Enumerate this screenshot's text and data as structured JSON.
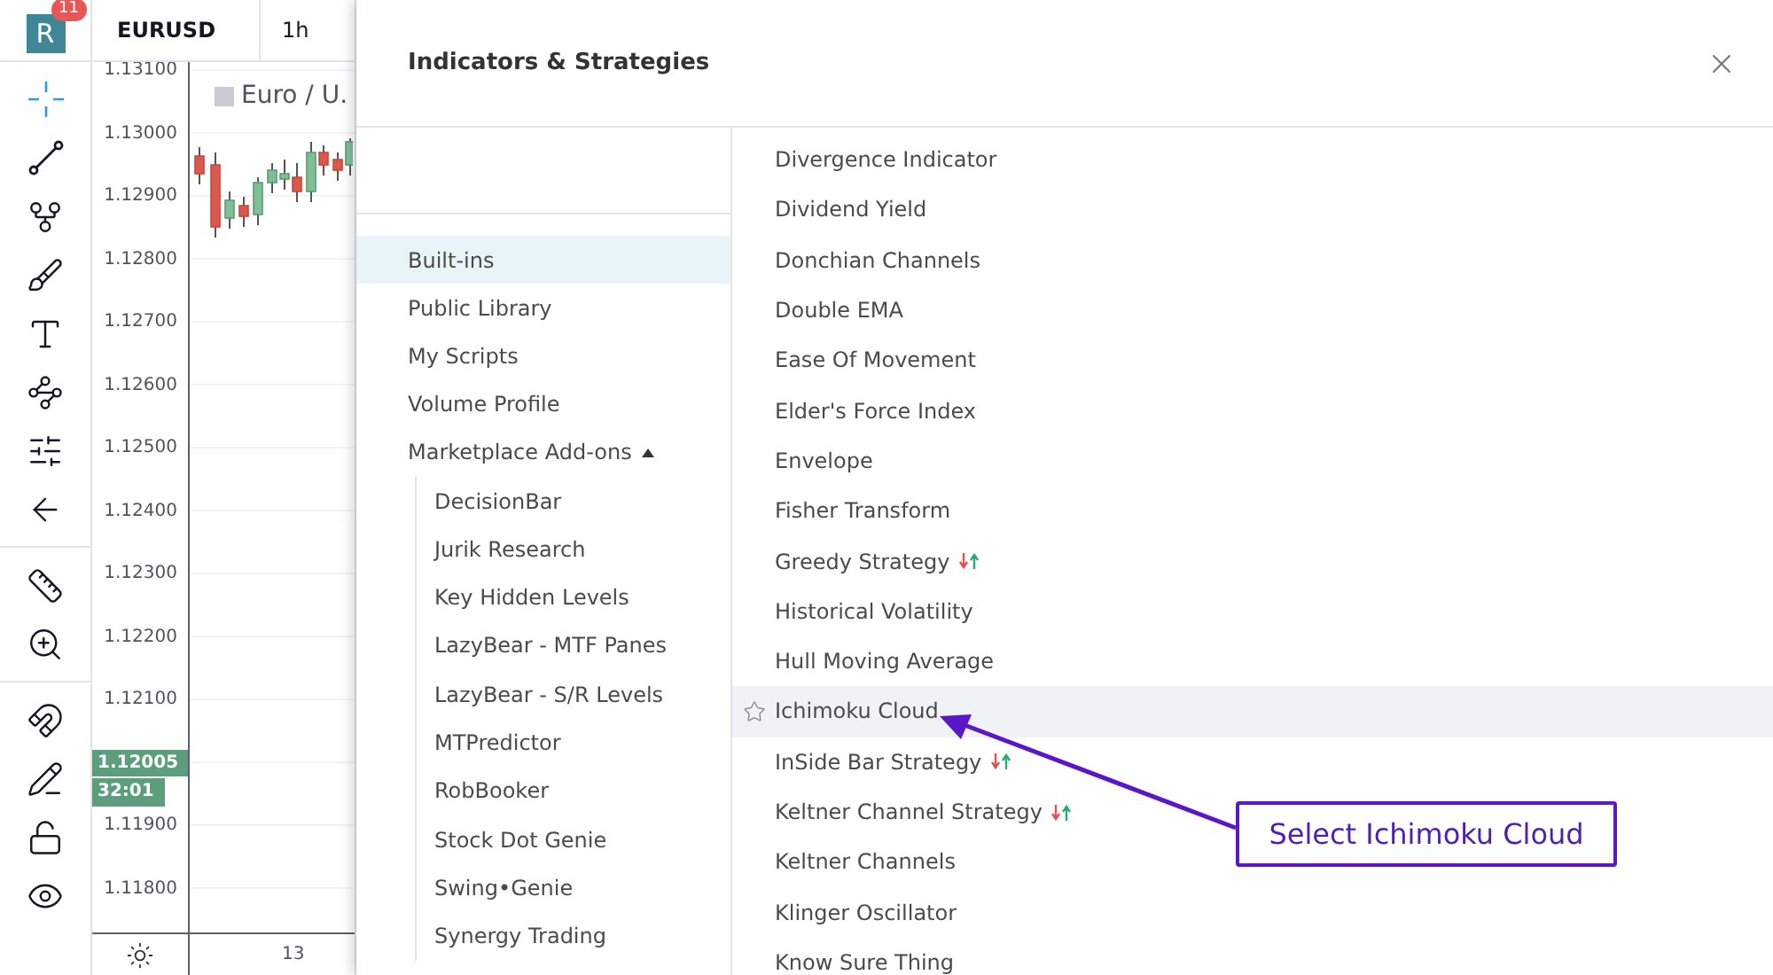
{
  "logo": {
    "letter": "R",
    "badge": "11"
  },
  "toolbar": {
    "groups": [
      [
        {
          "kind": "crosshair",
          "selected": true
        },
        {
          "kind": "trend-line",
          "selected": false
        },
        {
          "kind": "fork",
          "selected": false
        },
        {
          "kind": "brush",
          "selected": false
        },
        {
          "kind": "text",
          "selected": false
        },
        {
          "kind": "pattern",
          "selected": false
        },
        {
          "kind": "sliders",
          "selected": false
        },
        {
          "kind": "arrow-left",
          "selected": false
        }
      ],
      [
        {
          "kind": "ruler",
          "selected": false
        },
        {
          "kind": "zoom-in",
          "selected": false
        }
      ],
      [
        {
          "kind": "magnet",
          "selected": false
        },
        {
          "kind": "pencil-lock",
          "selected": false
        },
        {
          "kind": "unlock",
          "selected": false
        },
        {
          "kind": "eye",
          "selected": false
        }
      ]
    ]
  },
  "chart": {
    "symbol": "EURUSD",
    "interval": "1h",
    "legend": "Euro / U.",
    "axis": [
      {
        "kind": "label",
        "text": "1.13100"
      },
      {
        "kind": "label",
        "text": "1.13000"
      },
      {
        "kind": "label",
        "text": "1.12900"
      },
      {
        "kind": "label",
        "text": "1.12800"
      },
      {
        "kind": "label",
        "text": "1.12700"
      },
      {
        "kind": "label",
        "text": "1.12600"
      },
      {
        "kind": "label",
        "text": "1.12500"
      },
      {
        "kind": "label",
        "text": "1.12400"
      },
      {
        "kind": "label",
        "text": "1.12300"
      },
      {
        "kind": "label",
        "text": "1.12200"
      },
      {
        "kind": "label",
        "text": "1.12100"
      },
      {
        "kind": "price_tag",
        "text": "1.12005",
        "countdown": "32:01"
      },
      {
        "kind": "label",
        "text": "1.11900"
      },
      {
        "kind": "label",
        "text": "1.11800"
      }
    ],
    "time_labels": [
      "13"
    ]
  },
  "dialog": {
    "title": "Indicators & Strategies",
    "categories": [
      {
        "label": "Built-ins",
        "selected": true
      },
      {
        "label": "Public Library",
        "selected": false
      },
      {
        "label": "My Scripts",
        "selected": false
      },
      {
        "label": "Volume Profile",
        "selected": false
      },
      {
        "label": "Marketplace Add-ons",
        "selected": false,
        "expanded": true,
        "children": [
          {
            "label": "DecisionBar",
            "selected": false
          },
          {
            "label": "Jurik Research",
            "selected": false
          },
          {
            "label": "Key Hidden Levels",
            "selected": false
          },
          {
            "label": "LazyBear - MTF Panes",
            "selected": false
          },
          {
            "label": "LazyBear - S/R Levels",
            "selected": false
          },
          {
            "label": "MTPredictor",
            "selected": false
          },
          {
            "label": "RobBooker",
            "selected": false
          },
          {
            "label": "Stock Dot Genie",
            "selected": false
          },
          {
            "label": "Swing•Genie",
            "selected": false
          },
          {
            "label": "Synergy Trading",
            "selected": false
          }
        ]
      }
    ],
    "results": [
      {
        "name": "Divergence Indicator",
        "kind": "indicator",
        "highlighted": false
      },
      {
        "name": "Dividend Yield",
        "kind": "indicator",
        "highlighted": false
      },
      {
        "name": "Donchian Channels",
        "kind": "indicator",
        "highlighted": false
      },
      {
        "name": "Double EMA",
        "kind": "indicator",
        "highlighted": false
      },
      {
        "name": "Ease Of Movement",
        "kind": "indicator",
        "highlighted": false
      },
      {
        "name": "Elder's Force Index",
        "kind": "indicator",
        "highlighted": false
      },
      {
        "name": "Envelope",
        "kind": "indicator",
        "highlighted": false
      },
      {
        "name": "Fisher Transform",
        "kind": "indicator",
        "highlighted": false
      },
      {
        "name": "Greedy Strategy",
        "kind": "strategy",
        "highlighted": false
      },
      {
        "name": "Historical Volatility",
        "kind": "indicator",
        "highlighted": false
      },
      {
        "name": "Hull Moving Average",
        "kind": "indicator",
        "highlighted": false
      },
      {
        "name": "Ichimoku Cloud",
        "kind": "indicator",
        "highlighted": true
      },
      {
        "name": "InSide Bar Strategy",
        "kind": "strategy",
        "highlighted": false
      },
      {
        "name": "Keltner Channel Strategy",
        "kind": "strategy",
        "highlighted": false
      },
      {
        "name": "Keltner Channels",
        "kind": "indicator",
        "highlighted": false
      },
      {
        "name": "Klinger Oscillator",
        "kind": "indicator",
        "highlighted": false
      },
      {
        "name": "Know Sure Thing",
        "kind": "indicator",
        "highlighted": false
      }
    ]
  },
  "annotation": {
    "text": "Select Ichimoku Cloud"
  }
}
